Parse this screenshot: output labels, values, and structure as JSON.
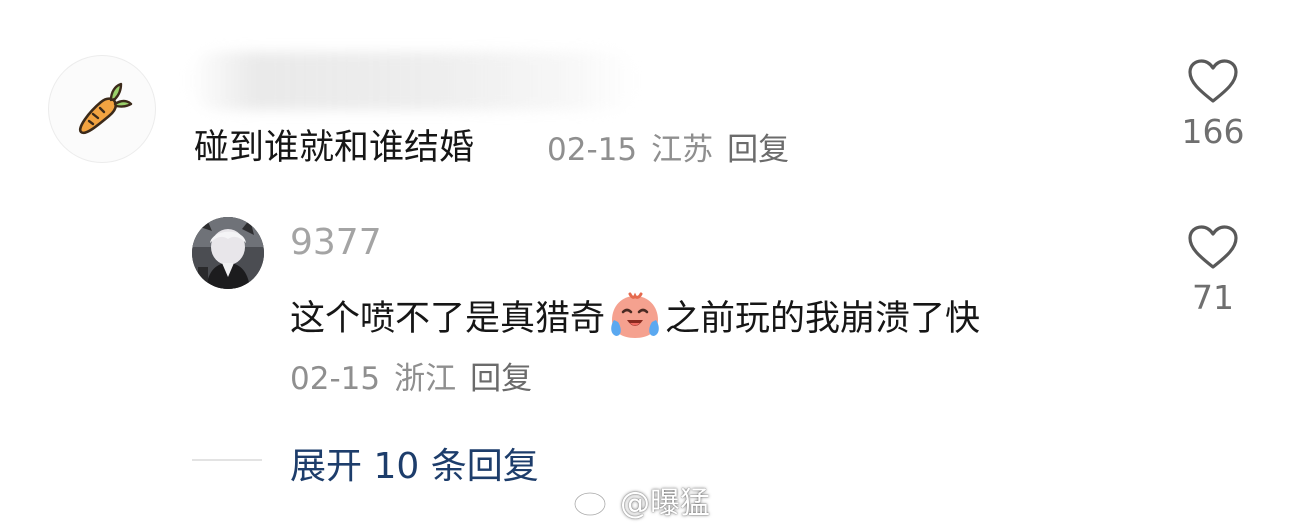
{
  "comment": {
    "text": "碰到谁就和谁结婚",
    "date": "02-15",
    "region": "江苏",
    "reply_label": "回复",
    "likes": "166",
    "avatar_icon": "carrot-icon"
  },
  "reply": {
    "username": "9377",
    "text_before": "这个喷不了是真猎奇",
    "emoji": "crying-face-emoji",
    "text_after": "之前玩的我崩溃了快",
    "date": "02-15",
    "region": "浙江",
    "reply_label": "回复",
    "likes": "71"
  },
  "expand": {
    "label": "展开 10 条回复"
  },
  "watermark": {
    "text": "@曝猛"
  },
  "colors": {
    "link": "#1d3d6b",
    "meta": "#8f8f8f",
    "carrot": "#f0a040"
  }
}
